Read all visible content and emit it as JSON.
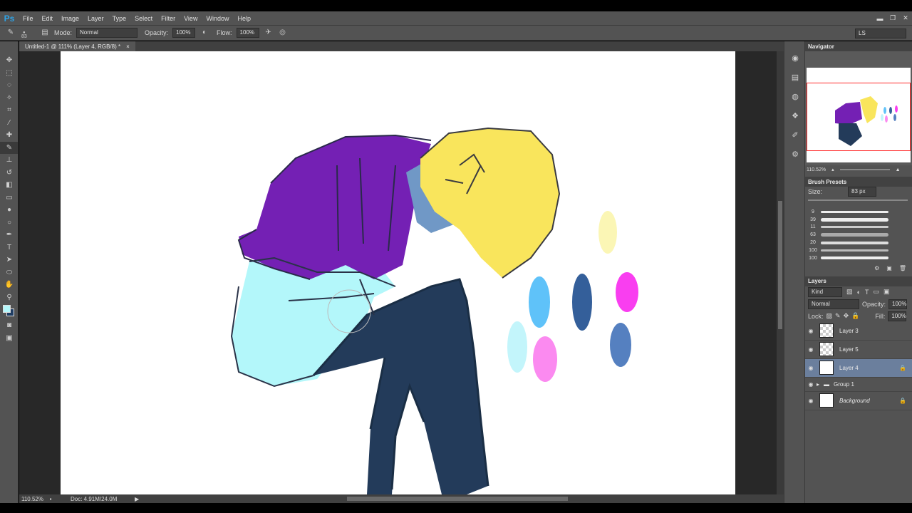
{
  "app": {
    "logo": "Ps"
  },
  "menu": [
    "File",
    "Edit",
    "Image",
    "Layer",
    "Type",
    "Select",
    "Filter",
    "View",
    "Window",
    "Help"
  ],
  "window_controls": {
    "minimize": "▬",
    "restore": "❐",
    "close": "✕"
  },
  "options": {
    "brush_size": "83",
    "mode_label": "Mode:",
    "mode_value": "Normal",
    "opacity_label": "Opacity:",
    "opacity_value": "100%",
    "flow_label": "Flow:",
    "flow_value": "100%",
    "workspace": "LS"
  },
  "document": {
    "tab_title": "Untitled-1 @ 111% (Layer 4, RGB/8) *",
    "tab_close": "×",
    "zoom": "110.52%",
    "doc_size": "Doc: 4.91M/24.0M"
  },
  "colors": {
    "foreground": "#b3f7fa",
    "background": "#1f3d63"
  },
  "navigator": {
    "title": "Navigator",
    "zoom": "110.52%"
  },
  "brush_presets": {
    "title": "Brush Presets",
    "size_label": "Size:",
    "size_value": "83 px",
    "sizes": [
      "9",
      "39",
      "11",
      "63",
      "20",
      "100",
      "100"
    ]
  },
  "layers": {
    "title": "Layers",
    "filter": "Kind",
    "blend": "Normal",
    "opacity_label": "Opacity:",
    "opacity_value": "100%",
    "lock_label": "Lock:",
    "fill_label": "Fill:",
    "fill_value": "100%",
    "items": [
      {
        "name": "Layer 3"
      },
      {
        "name": "Layer 5"
      },
      {
        "name": "Layer 4"
      },
      {
        "name": "Group 1"
      },
      {
        "name": "Background"
      }
    ]
  }
}
